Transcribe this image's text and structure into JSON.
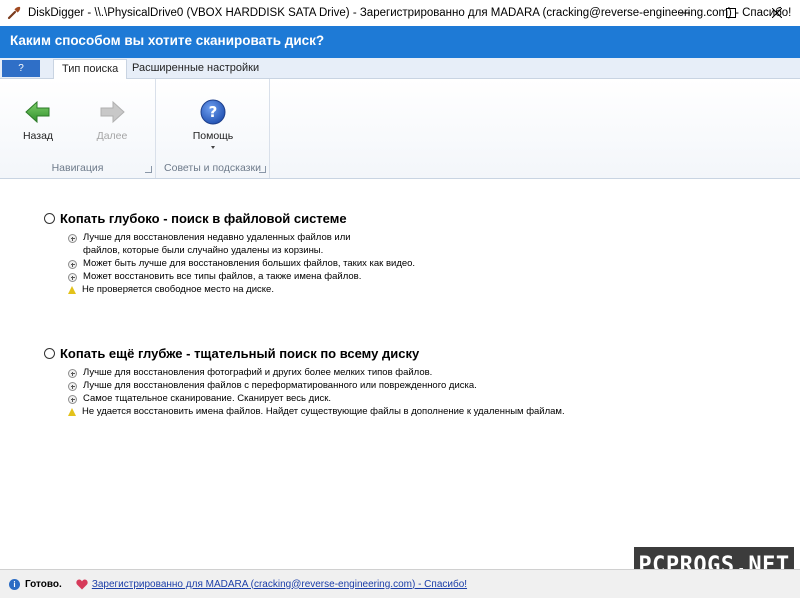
{
  "window": {
    "title": "DiskDigger - \\\\.\\PhysicalDrive0 (VBOX HARDDISK SATA Drive) - Зарегистрированно для MADARA (cracking@reverse-engineering.com) - Спасибо!"
  },
  "header": {
    "title": "Каким способом вы хотите сканировать диск?"
  },
  "ribbon": {
    "app_tab": "?",
    "tabs": [
      {
        "label": "Тип поиска",
        "active": true
      },
      {
        "label": "Расширенные настройки",
        "active": false
      }
    ],
    "groups": {
      "navigation": {
        "label": "Навигация",
        "back_label": "Назад",
        "forward_label": "Далее"
      },
      "tips": {
        "label": "Советы и подсказки",
        "help_label": "Помощь"
      }
    }
  },
  "options": [
    {
      "title": "Копать глубоко - поиск в файловой системе",
      "bullets": [
        {
          "type": "plus",
          "text": "Лучше для восстановления недавно удаленных файлов или"
        },
        {
          "type": "none",
          "text": "файлов, которые были случайно удалены из корзины."
        },
        {
          "type": "plus",
          "text": "Может быть лучше для восстановления больших файлов, таких как видео."
        },
        {
          "type": "plus",
          "text": "Может восстановить все типы файлов, а также имена файлов."
        },
        {
          "type": "warn",
          "text": "Не проверяется свободное место на диске."
        }
      ]
    },
    {
      "title": "Копать ещё глубже - тщательный поиск по всему диску",
      "bullets": [
        {
          "type": "plus",
          "text": "Лучше для восстановления фотографий и других более мелких типов файлов."
        },
        {
          "type": "plus",
          "text": "Лучше для восстановления файлов с переформатированного или поврежденного диска."
        },
        {
          "type": "plus",
          "text": "Самое тщательное сканирование. Сканирует весь диск."
        },
        {
          "type": "warn",
          "text": "Не удается восстановить имена файлов. Найдет существующие файлы в дополнение к удаленным файлам."
        }
      ]
    }
  ],
  "watermark": "PCPROGS.NET",
  "statusbar": {
    "ready": "Готово.",
    "link": "Зарегистрированно для MADARA (cracking@reverse-engineering.com) - Спасибо!"
  },
  "colors": {
    "header_blue": "#1e7ad6",
    "back_arrow_green": "#3aa335",
    "help_blue": "#2b5fc2"
  },
  "icons": [
    "app-shovel-icon",
    "minimize-icon",
    "maximize-icon",
    "close-icon",
    "back-arrow-icon",
    "forward-arrow-icon",
    "help-icon",
    "plus-bullet-icon",
    "warning-icon",
    "info-icon",
    "heart-icon"
  ]
}
